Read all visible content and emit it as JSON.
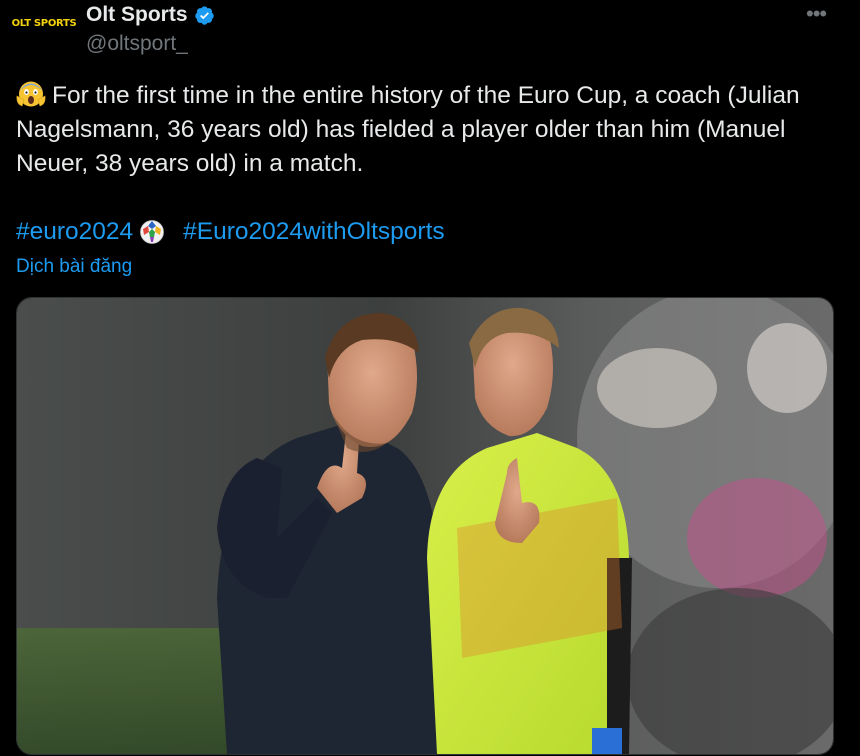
{
  "account": {
    "avatar_text": "OLT SPORTS",
    "display_name": "Olt Sports",
    "handle": "@oltsport_",
    "verified": true
  },
  "more_label": "•••",
  "tweet": {
    "text": "For the first time in the entire history of the Euro Cup, a coach (Julian Nagelsmann, 36 years old) has fielded a player older than him (Manuel Neuer, 38 years old) in a match.",
    "leading_emoji": "face-screaming-in-fear",
    "hashtags": [
      "#euro2024",
      "#Euro2024withOltsports"
    ],
    "hashtag_emoji": "euro-2024-ball"
  },
  "translate_label": "Dịch bài đăng",
  "colors": {
    "link": "#1d9bf0",
    "text": "#e7e9ea",
    "secondary": "#71767b",
    "verified": "#1d9bf0"
  }
}
